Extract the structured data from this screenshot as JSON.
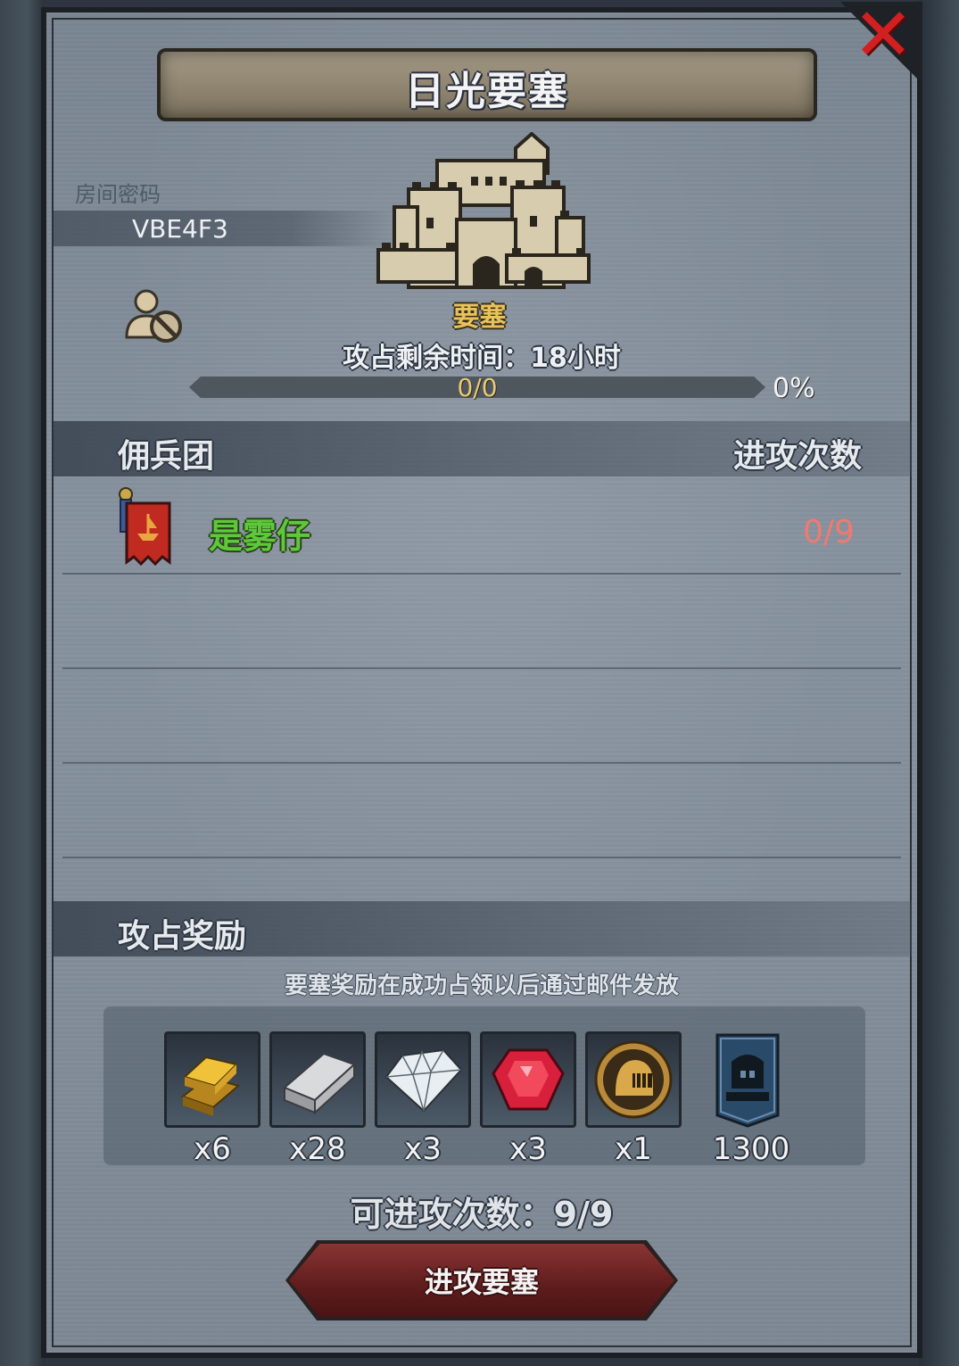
{
  "title": "日光要塞",
  "close_icon": "close-icon",
  "room": {
    "label": "房间密码",
    "code": "VBE4F3"
  },
  "fortress": {
    "label": "要塞",
    "time_label": "攻占剩余时间：",
    "time_value": "18小时",
    "progress_text": "0/0",
    "progress_percent": "0%",
    "progress_fraction": 0
  },
  "mercenary_section": {
    "title": "佣兵团",
    "attacks_header": "进攻次数",
    "rows": [
      {
        "name": "是雾仔",
        "attacks": "0/9",
        "name_color": "#5ec83c"
      }
    ]
  },
  "rewards_section": {
    "title": "攻占奖励",
    "note": "要塞奖励在成功占领以后通过邮件发放",
    "items": [
      {
        "icon": "gold-bars-icon",
        "qty": "x6"
      },
      {
        "icon": "iron-ingot-icon",
        "qty": "x28"
      },
      {
        "icon": "diamond-icon",
        "qty": "x3"
      },
      {
        "icon": "ruby-icon",
        "qty": "x3"
      },
      {
        "icon": "knight-helmet-icon",
        "qty": "x1"
      },
      {
        "icon": "castle-banner-icon",
        "qty": "1300"
      }
    ]
  },
  "attack_count": {
    "label": "可进攻次数：",
    "value": "9/9"
  },
  "attack_button_label": "进攻要塞",
  "colors": {
    "accent_gold": "#e8c25a",
    "merc_green": "#5ec83c",
    "attack_red": "#f07a70",
    "close_red": "#d21f1f",
    "button_red": "#6e2222"
  }
}
